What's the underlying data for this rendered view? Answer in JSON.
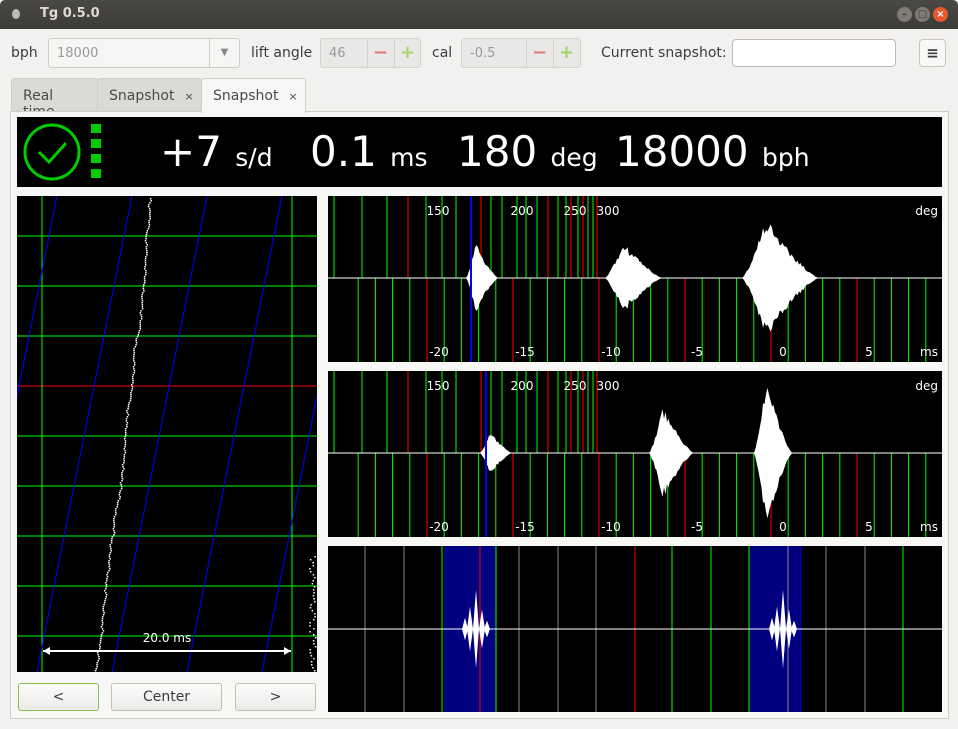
{
  "window": {
    "title": "Tg 0.5.0"
  },
  "toolbar": {
    "bph_label": "bph",
    "bph_value": "18000",
    "lift_label": "lift angle",
    "lift_value": "46",
    "cal_label": "cal",
    "cal_value": "-0.5",
    "snapshot_label": "Current snapshot:",
    "snapshot_value": "",
    "minus": "−",
    "plus": "+",
    "menu": "≡"
  },
  "tabs": [
    {
      "label": "Real time"
    },
    {
      "label": "Snapshot",
      "close": "×"
    },
    {
      "label": "Snapshot",
      "close": "×",
      "active": true
    }
  ],
  "readout": {
    "rate": "+7",
    "rate_unit": "s/d",
    "beat_error": "0.1",
    "beat_error_unit": "ms",
    "amplitude": "180",
    "amplitude_unit": "deg",
    "bph": "18000",
    "bph_unit": "bph"
  },
  "paperstrip": {
    "scale_label": "20.0 ms"
  },
  "buttons": {
    "left": "<",
    "center": "Center",
    "right": ">"
  },
  "waveform": {
    "deg_ticks": [
      "150",
      "200",
      "250",
      "300"
    ],
    "deg_unit": "deg",
    "ms_ticks": [
      "-20",
      "-15",
      "-10",
      "-5",
      "0",
      "5"
    ],
    "ms_unit": "ms"
  },
  "colors": {
    "grid_green": "#00ff00",
    "grid_red": "#ff0000",
    "marker_blue": "#0000ff",
    "highlight": "#000080",
    "status_green": "#00cc00"
  }
}
